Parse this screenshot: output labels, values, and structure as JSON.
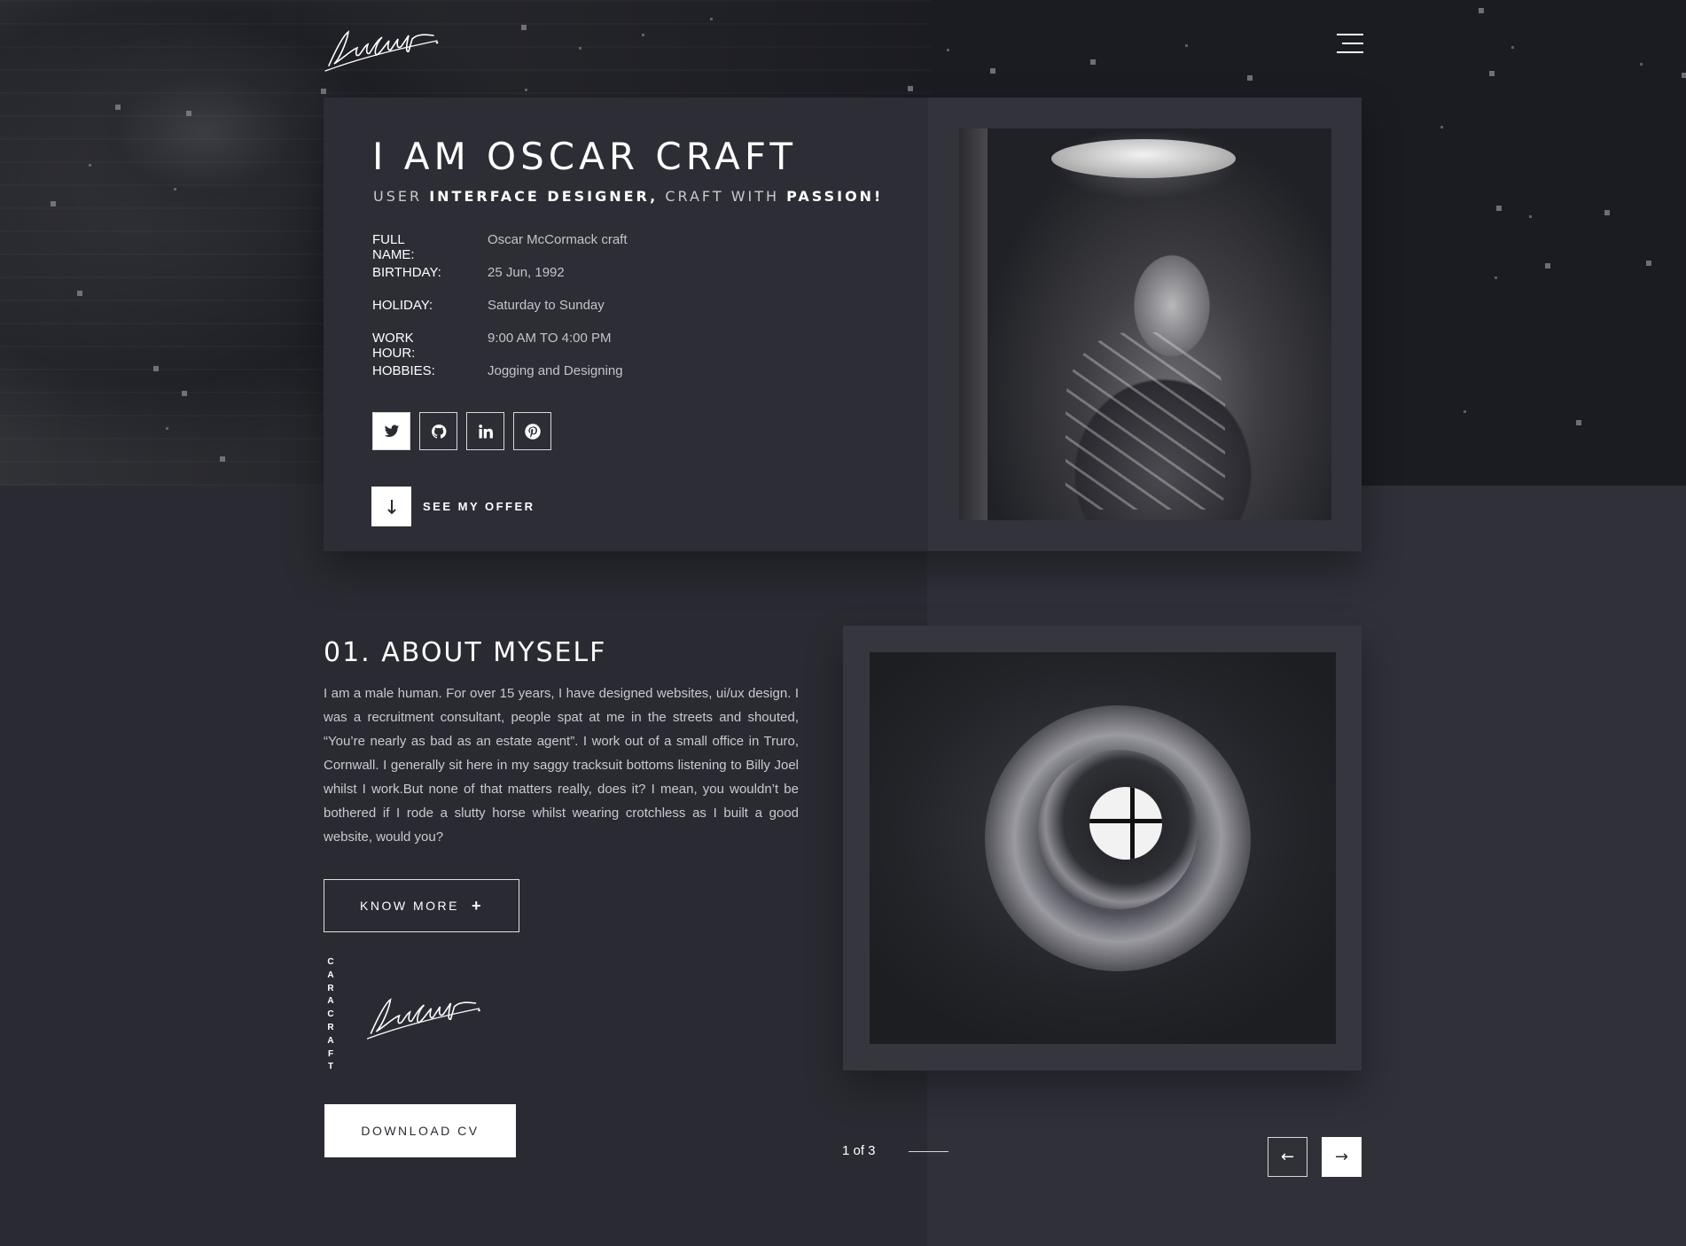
{
  "header": {
    "logo_icon": "signature-logo",
    "menu_icon": "hamburger-menu-icon"
  },
  "hero": {
    "title": "I AM OSCAR CRAFT",
    "subtitle": {
      "part1": "USER ",
      "part2": "INTERFACE DESIGNER,",
      "part3": " CRAFT WITH ",
      "part4": "PASSION!"
    },
    "info": [
      {
        "label": "FULL NAME:",
        "value": "Oscar McCormack craft"
      },
      {
        "label": "BIRTHDAY:",
        "value": "25 Jun, 1992"
      },
      {
        "label": "HOLIDAY:",
        "value": "Saturday to Sunday"
      },
      {
        "label": "WORK HOUR:",
        "value": "9:00 AM TO 4:00 PM"
      },
      {
        "label": "HOBBIES:",
        "value": "Jogging and Designing"
      }
    ],
    "socials": [
      "twitter-icon",
      "github-icon",
      "linkedin-icon",
      "pinterest-icon"
    ],
    "offer_label": "SEE MY OFFER",
    "offer_icon": "arrow-down-icon"
  },
  "about": {
    "title": "01. ABOUT MYSELF",
    "text": "I am a male human. For over 15 years, I have designed websites, ui/ux design. I was a recruitment consultant, people spat at me in the streets and shouted, “You’re nearly as bad as an estate agent”. I work out of a small office in Truro, Cornwall. I generally sit here in my saggy tracksuit bottoms listening to Billy Joel whilst I work.But none of that matters really, does it? I mean, you wouldn’t be bothered if I rode a slutty horse whilst wearing crotchless as I built a good website, would you?",
    "know_more_label": "KNOW MORE",
    "know_more_icon": "+",
    "vertical_name": "CARACRAFT",
    "download_label": "DOWNLOAD CV"
  },
  "slider": {
    "counter": "1 of 3",
    "prev_icon": "←",
    "next_icon": "→"
  },
  "colors": {
    "background": "#2a2b32",
    "hero_background": "#1b1c22",
    "card": "#2c2d35",
    "accent": "#ffffff"
  }
}
